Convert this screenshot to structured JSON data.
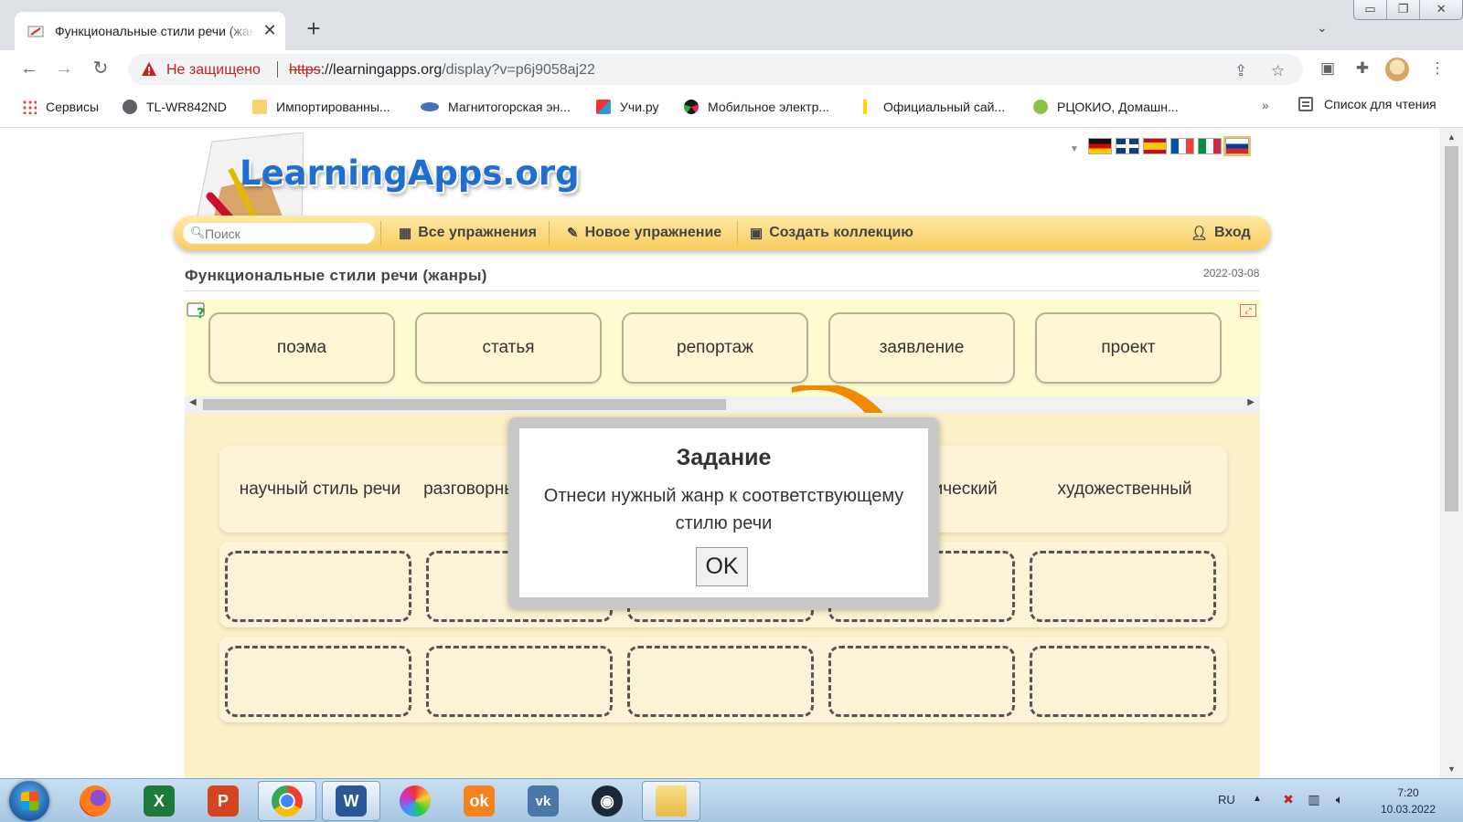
{
  "browser": {
    "tab_title": "Функциональные стили речи (жанры)",
    "new_tab": "+",
    "not_secure": "Не защищено",
    "url_scheme": "https",
    "url_host": "://learningapps.org",
    "url_path": "/display?v=p6j9058aj22"
  },
  "bookmarks": [
    {
      "label": "Сервисы",
      "icon": "apps-grid-icon"
    },
    {
      "label": "TL-WR842ND",
      "icon": "globe-icon"
    },
    {
      "label": "Импортированны...",
      "icon": "folder-icon"
    },
    {
      "label": "Магнитогорская эн...",
      "icon": "eye-logo-icon"
    },
    {
      "label": "Учи.ру",
      "icon": "uchi-icon"
    },
    {
      "label": "Мобильное электр...",
      "icon": "mesh-logo-icon"
    },
    {
      "label": "Официальный сай...",
      "icon": "yellow-bar-icon"
    },
    {
      "label": "РЦОКИО, Домашн...",
      "icon": "green-logo-icon"
    }
  ],
  "bookmarks_more": "»",
  "reading_list": "Список для чтения",
  "site": {
    "logo_text": "LearningApps.org",
    "search_placeholder": "Поиск",
    "menu": {
      "all_apps": "Все упражнения",
      "new_app": "Новое упражнение",
      "create_collection": "Создать коллекцию",
      "login": "Вход"
    },
    "app_title": "Функциональные стили речи (жанры)",
    "app_date": "2022-03-08"
  },
  "exercise": {
    "cards": [
      "поэма",
      "статья",
      "репортаж",
      "заявление",
      "проект"
    ],
    "categories": [
      "научный стиль речи",
      "разговорный стиль речи",
      "",
      "публицистический",
      "художественный"
    ]
  },
  "modal": {
    "title": "Задание",
    "text": "Отнеси нужный жанр к соответствующему стилю речи",
    "ok": "OK"
  },
  "tray": {
    "lang": "RU",
    "time": "7:20",
    "date": "10.03.2022"
  },
  "colors": {
    "menubar": "#f8cd5e",
    "exercise_bg": "#fcf0c8",
    "logo_blue": "#1e6fd0",
    "insecure_red": "#c5221f"
  }
}
